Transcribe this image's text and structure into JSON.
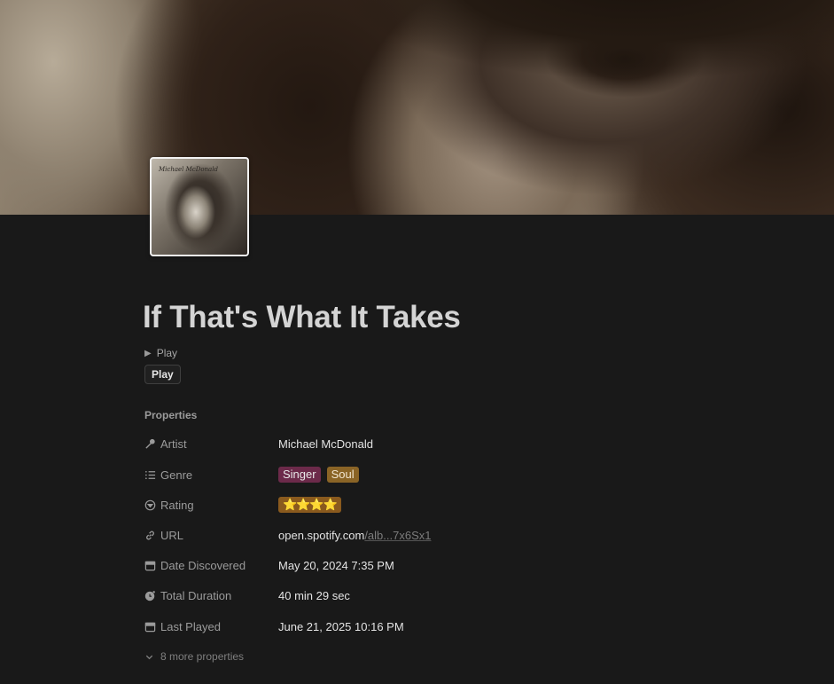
{
  "page": {
    "title": "If That's What It Takes",
    "toggle_label": "Play",
    "play_button_label": "Play",
    "album_thumbnail_text": "Michael McDonald"
  },
  "properties": {
    "heading": "Properties",
    "artist": {
      "label": "Artist",
      "value": "Michael McDonald",
      "icon": "microphone-icon"
    },
    "genre": {
      "label": "Genre",
      "icon": "list-icon",
      "tags": [
        "Singer",
        "Soul"
      ]
    },
    "rating": {
      "label": "Rating",
      "icon": "select-circle-icon",
      "value": "⭐⭐⭐⭐"
    },
    "url": {
      "label": "URL",
      "icon": "link-icon",
      "domain": "open.spotify.com",
      "rest": "/alb...7x6Sx1"
    },
    "date_discovered": {
      "label": "Date Discovered",
      "icon": "calendar-icon",
      "value": "May 20, 2024 7:35 PM"
    },
    "total_duration": {
      "label": "Total Duration",
      "icon": "formula-clock-icon",
      "value": "40 min 29 sec"
    },
    "last_played": {
      "label": "Last Played",
      "icon": "calendar-icon",
      "value": "June 21, 2025 10:16 PM"
    },
    "more": "8 more properties"
  },
  "colors": {
    "background": "#191919",
    "tag_singer": "#6c2a4a",
    "tag_soul": "#8a6426",
    "tag_rating": "#8a5a1e"
  }
}
